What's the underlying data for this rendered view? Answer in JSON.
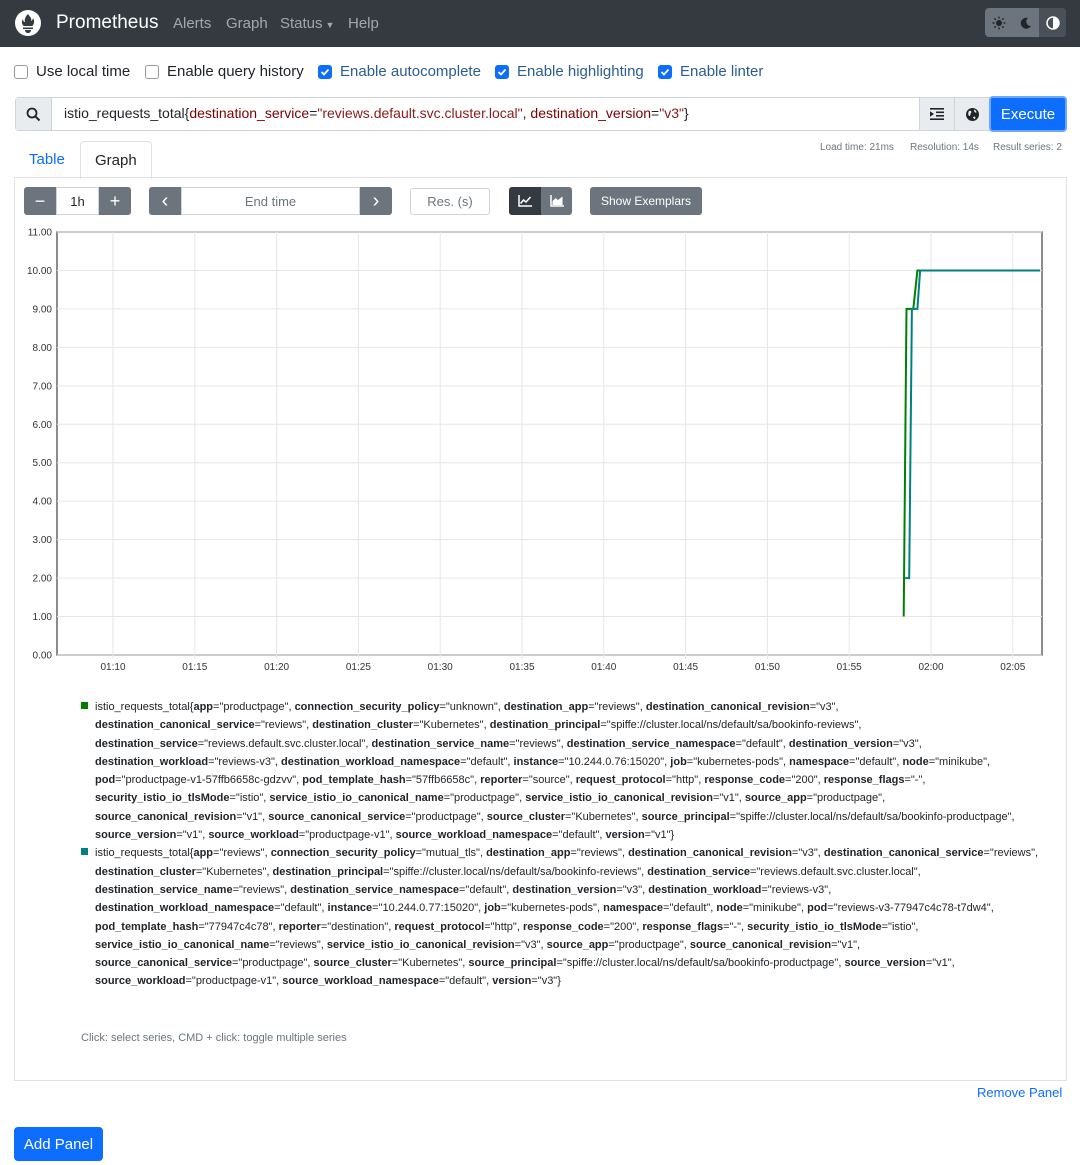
{
  "navbar": {
    "brand": "Prometheus",
    "links": [
      "Alerts",
      "Graph",
      "Status",
      "Help"
    ]
  },
  "options": [
    {
      "label": "Use local time",
      "checked": false
    },
    {
      "label": "Enable query history",
      "checked": false
    },
    {
      "label": "Enable autocomplete",
      "checked": true
    },
    {
      "label": "Enable highlighting",
      "checked": true
    },
    {
      "label": "Enable linter",
      "checked": true
    }
  ],
  "query": {
    "metric": "istio_requests_total",
    "l1": "destination_service",
    "v1": "\"reviews.default.svc.cluster.local\"",
    "l2": "destination_version",
    "v2": "\"v3\"",
    "execute_label": "Execute"
  },
  "tabs": {
    "table": "Table",
    "graph": "Graph"
  },
  "stats": {
    "load": "Load time: 21ms",
    "resolution": "Resolution: 14s",
    "series": "Result series: 2"
  },
  "controls": {
    "minus": "−",
    "range": "1h",
    "plus": "+",
    "prev": "‹",
    "end_time_placeholder": "End time",
    "next": "›",
    "res_placeholder": "Res. (s)",
    "exemplars": "Show Exemplars"
  },
  "chart_data": {
    "type": "line",
    "x_ticks": [
      "01:10",
      "01:15",
      "01:20",
      "01:25",
      "01:30",
      "01:35",
      "01:40",
      "01:45",
      "01:50",
      "01:55",
      "02:00",
      "02:05"
    ],
    "y_ticks": [
      "0.00",
      "1.00",
      "2.00",
      "3.00",
      "4.00",
      "5.00",
      "6.00",
      "7.00",
      "8.00",
      "9.00",
      "10.00",
      "11.00"
    ],
    "ylim": [
      0,
      11
    ],
    "grid": true,
    "series": [
      {
        "color": "#008000",
        "points": [
          [
            "01:58:20",
            1
          ],
          [
            "01:58:30",
            9
          ],
          [
            "01:58:55",
            9
          ],
          [
            "01:59:10",
            10
          ],
          [
            "02:06:40",
            10
          ]
        ]
      },
      {
        "color": "#008080",
        "points": [
          [
            "01:58:25",
            2
          ],
          [
            "01:58:40",
            2
          ],
          [
            "01:58:50",
            9
          ],
          [
            "01:59:10",
            9
          ],
          [
            "01:59:20",
            10
          ],
          [
            "02:06:40",
            10
          ]
        ]
      }
    ]
  },
  "legend": [
    {
      "color": "#008000",
      "metric": "istio_requests_total",
      "labels": [
        [
          "app",
          "productpage"
        ],
        [
          "connection_security_policy",
          "unknown"
        ],
        [
          "destination_app",
          "reviews"
        ],
        [
          "destination_canonical_revision",
          "v3"
        ],
        [
          "destination_canonical_service",
          "reviews"
        ],
        [
          "destination_cluster",
          "Kubernetes"
        ],
        [
          "destination_principal",
          "spiffe://cluster.local/ns/default/sa/bookinfo-reviews"
        ],
        [
          "destination_service",
          "reviews.default.svc.cluster.local"
        ],
        [
          "destination_service_name",
          "reviews"
        ],
        [
          "destination_service_namespace",
          "default"
        ],
        [
          "destination_version",
          "v3"
        ],
        [
          "destination_workload",
          "reviews-v3"
        ],
        [
          "destination_workload_namespace",
          "default"
        ],
        [
          "instance",
          "10.244.0.76:15020"
        ],
        [
          "job",
          "kubernetes-pods"
        ],
        [
          "namespace",
          "default"
        ],
        [
          "node",
          "minikube"
        ],
        [
          "pod",
          "productpage-v1-57ffb6658c-gdzvv"
        ],
        [
          "pod_template_hash",
          "57ffb6658c"
        ],
        [
          "reporter",
          "source"
        ],
        [
          "request_protocol",
          "http"
        ],
        [
          "response_code",
          "200"
        ],
        [
          "response_flags",
          "-"
        ],
        [
          "security_istio_io_tlsMode",
          "istio"
        ],
        [
          "service_istio_io_canonical_name",
          "productpage"
        ],
        [
          "service_istio_io_canonical_revision",
          "v1"
        ],
        [
          "source_app",
          "productpage"
        ],
        [
          "source_canonical_revision",
          "v1"
        ],
        [
          "source_canonical_service",
          "productpage"
        ],
        [
          "source_cluster",
          "Kubernetes"
        ],
        [
          "source_principal",
          "spiffe://cluster.local/ns/default/sa/bookinfo-productpage"
        ],
        [
          "source_version",
          "v1"
        ],
        [
          "source_workload",
          "productpage-v1"
        ],
        [
          "source_workload_namespace",
          "default"
        ],
        [
          "version",
          "v1"
        ]
      ]
    },
    {
      "color": "#008080",
      "metric": "istio_requests_total",
      "labels": [
        [
          "app",
          "reviews"
        ],
        [
          "connection_security_policy",
          "mutual_tls"
        ],
        [
          "destination_app",
          "reviews"
        ],
        [
          "destination_canonical_revision",
          "v3"
        ],
        [
          "destination_canonical_service",
          "reviews"
        ],
        [
          "destination_cluster",
          "Kubernetes"
        ],
        [
          "destination_principal",
          "spiffe://cluster.local/ns/default/sa/bookinfo-reviews"
        ],
        [
          "destination_service",
          "reviews.default.svc.cluster.local"
        ],
        [
          "destination_service_name",
          "reviews"
        ],
        [
          "destination_service_namespace",
          "default"
        ],
        [
          "destination_version",
          "v3"
        ],
        [
          "destination_workload",
          "reviews-v3"
        ],
        [
          "destination_workload_namespace",
          "default"
        ],
        [
          "instance",
          "10.244.0.77:15020"
        ],
        [
          "job",
          "kubernetes-pods"
        ],
        [
          "namespace",
          "default"
        ],
        [
          "node",
          "minikube"
        ],
        [
          "pod",
          "reviews-v3-77947c4c78-t7dw4"
        ],
        [
          "pod_template_hash",
          "77947c4c78"
        ],
        [
          "reporter",
          "destination"
        ],
        [
          "request_protocol",
          "http"
        ],
        [
          "response_code",
          "200"
        ],
        [
          "response_flags",
          "-"
        ],
        [
          "security_istio_io_tlsMode",
          "istio"
        ],
        [
          "service_istio_io_canonical_name",
          "reviews"
        ],
        [
          "service_istio_io_canonical_revision",
          "v3"
        ],
        [
          "source_app",
          "productpage"
        ],
        [
          "source_canonical_revision",
          "v1"
        ],
        [
          "source_canonical_service",
          "productpage"
        ],
        [
          "source_cluster",
          "Kubernetes"
        ],
        [
          "source_principal",
          "spiffe://cluster.local/ns/default/sa/bookinfo-productpage"
        ],
        [
          "source_version",
          "v1"
        ],
        [
          "source_workload",
          "productpage-v1"
        ],
        [
          "source_workload_namespace",
          "default"
        ],
        [
          "version",
          "v3"
        ]
      ]
    }
  ],
  "legend_hint": "Click: select series, CMD + click: toggle multiple series",
  "remove_panel": "Remove Panel",
  "add_panel": "Add Panel"
}
